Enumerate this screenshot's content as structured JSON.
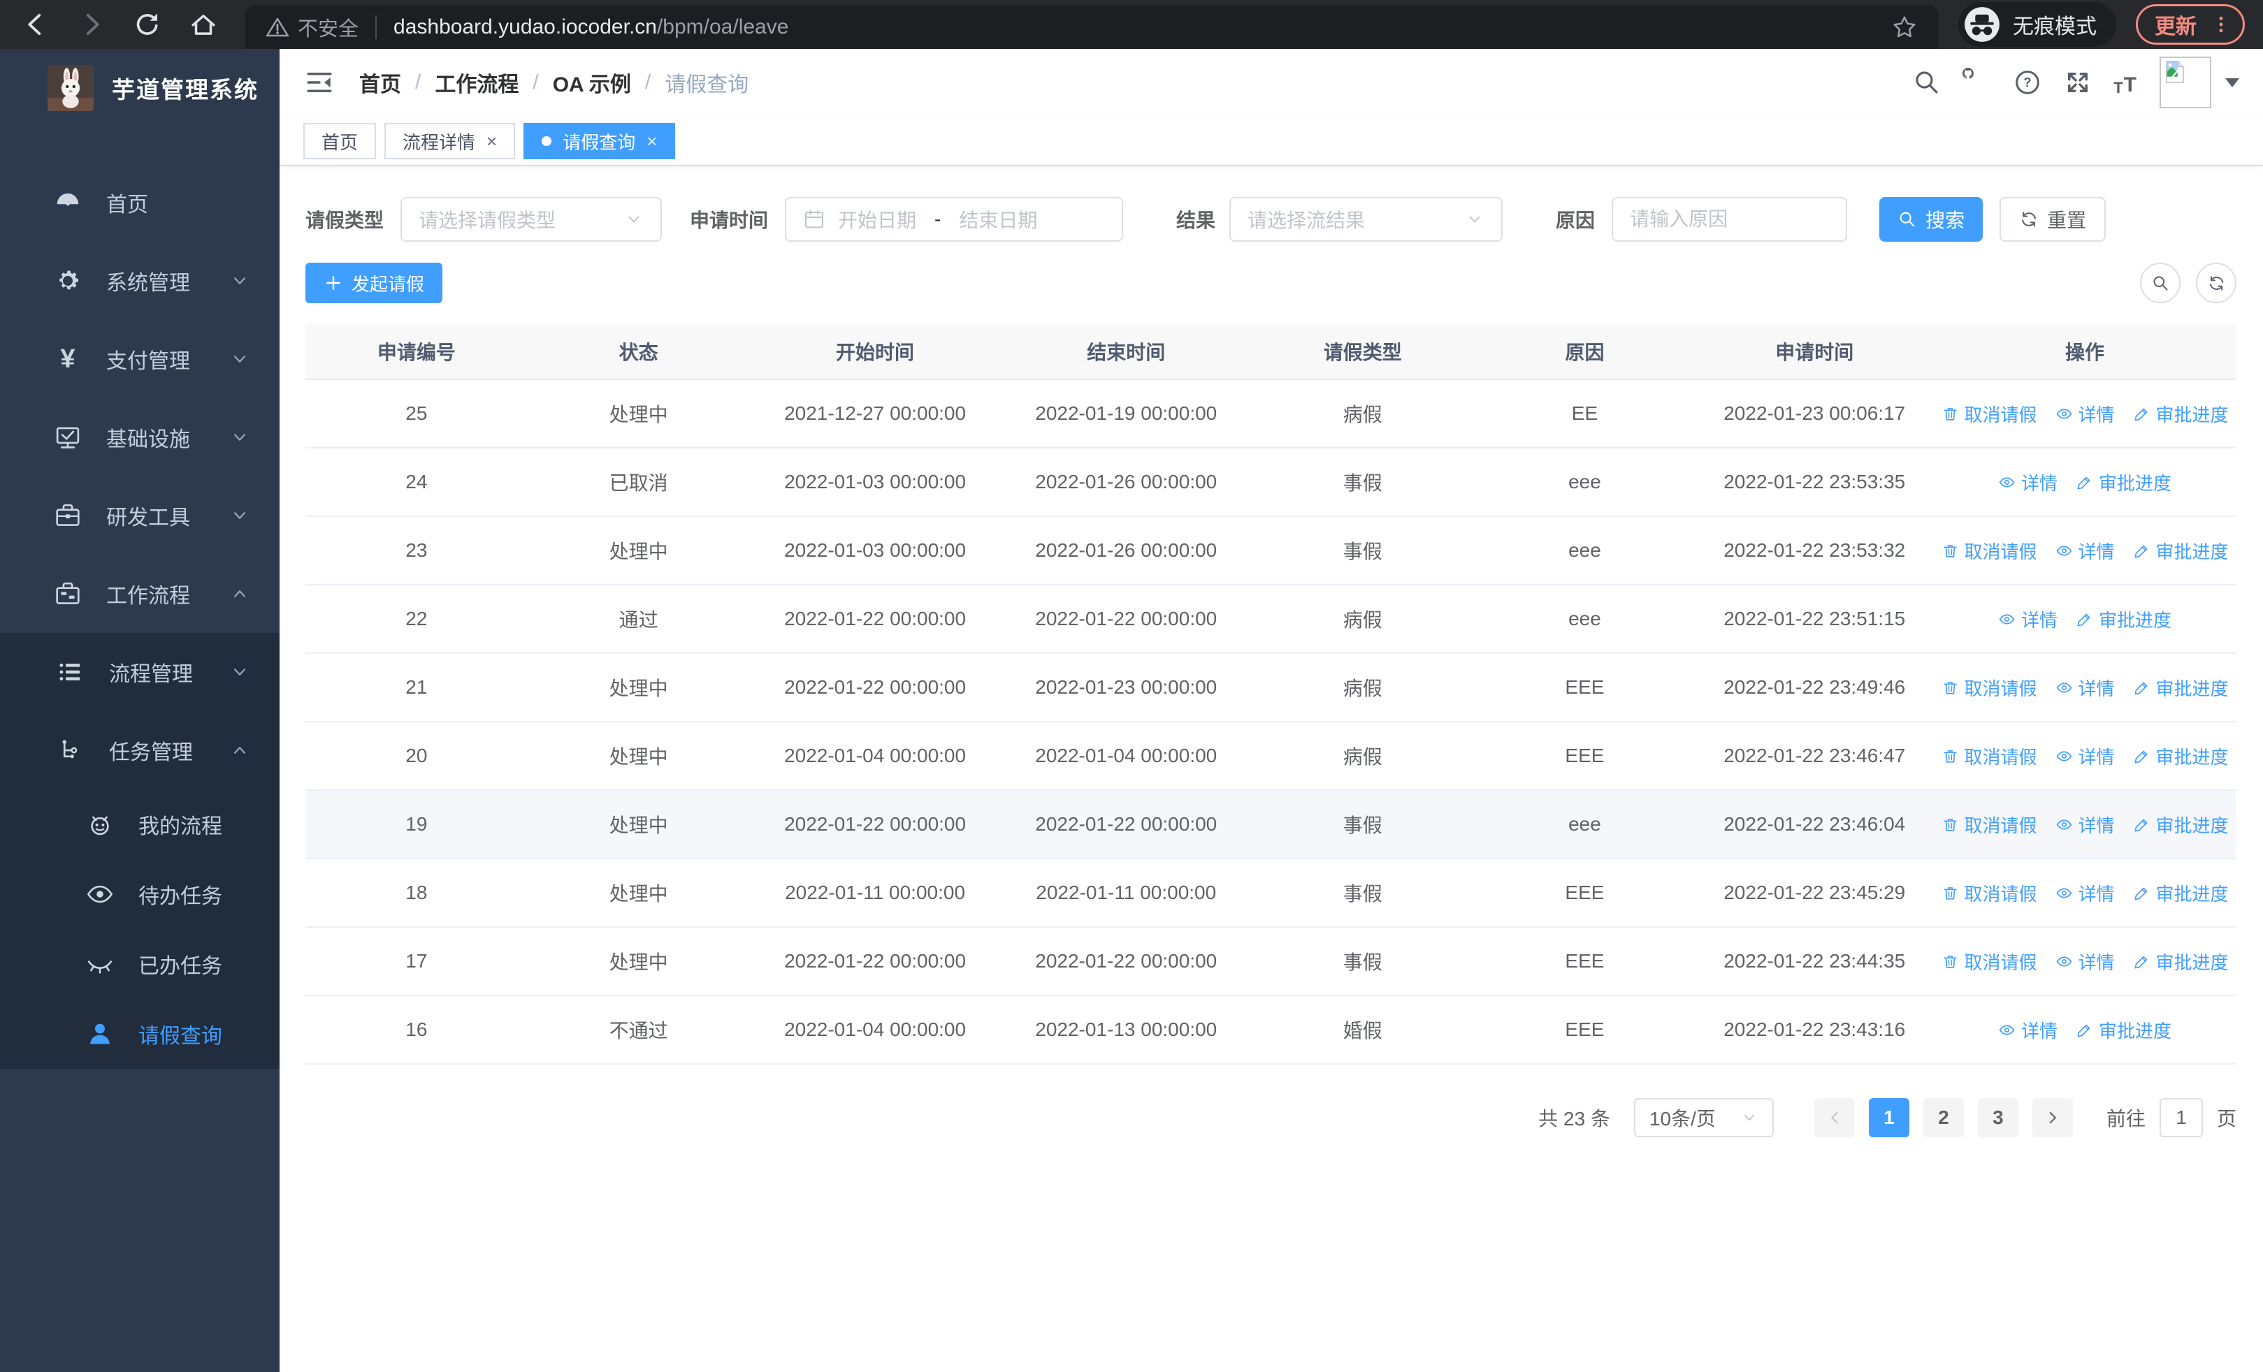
{
  "browser": {
    "security_label": "不安全",
    "url_host": "dashboard.yudao.iocoder.cn",
    "url_path": "/bpm/oa/leave",
    "incognito_label": "无痕模式",
    "update_label": "更新",
    "nav_icons": [
      "back-icon",
      "forward-icon",
      "reload-icon",
      "home-icon"
    ],
    "bookmark_icon": "star-icon",
    "menu_icon": "kebab-menu-icon"
  },
  "sidebar": {
    "logo_title": "芋道管理系统",
    "logo_icon": "rabbit-logo",
    "items": [
      {
        "label": "首页",
        "icon": "dashboard-icon",
        "chevron": null,
        "active": false
      },
      {
        "label": "系统管理",
        "icon": "gear-icon",
        "chevron": "down",
        "active": false
      },
      {
        "label": "支付管理",
        "icon": "yen-icon",
        "chevron": "down",
        "active": false
      },
      {
        "label": "基础设施",
        "icon": "monitor-icon",
        "chevron": "down",
        "active": false
      },
      {
        "label": "研发工具",
        "icon": "toolbox-icon",
        "chevron": "down",
        "active": false
      },
      {
        "label": "工作流程",
        "icon": "briefcase-icon",
        "chevron": "up",
        "active": false
      }
    ],
    "submenu": [
      {
        "label": "流程管理",
        "icon": "process-list-icon",
        "chevron": "down",
        "level": 1,
        "active": false
      },
      {
        "label": "任务管理",
        "icon": "task-flow-icon",
        "chevron": "up",
        "level": 1,
        "active": false
      },
      {
        "label": "我的流程",
        "icon": "robot-face-icon",
        "chevron": null,
        "level": 2,
        "active": false
      },
      {
        "label": "待办任务",
        "icon": "eye-open-icon",
        "chevron": null,
        "level": 2,
        "active": false
      },
      {
        "label": "已办任务",
        "icon": "eye-closed-icon",
        "chevron": null,
        "level": 2,
        "active": false
      },
      {
        "label": "请假查询",
        "icon": "user-icon",
        "chevron": null,
        "level": 2,
        "active": true
      }
    ]
  },
  "header": {
    "breadcrumb": [
      "首页",
      "工作流程",
      "OA 示例",
      "请假查询"
    ],
    "separator": "/",
    "icons": [
      "search-icon",
      "github-icon",
      "help-icon",
      "fullscreen-icon",
      "font-size-icon"
    ],
    "font_size_glyph": "T"
  },
  "tabs": [
    {
      "label": "首页",
      "closable": false,
      "active": false
    },
    {
      "label": "流程详情",
      "closable": true,
      "active": false
    },
    {
      "label": "请假查询",
      "closable": true,
      "active": true
    }
  ],
  "tab_close_glyph": "×",
  "filters": {
    "leave_type": {
      "label": "请假类型",
      "placeholder": "请选择请假类型"
    },
    "apply_time": {
      "label": "申请时间",
      "start_placeholder": "开始日期",
      "separator": "-",
      "end_placeholder": "结束日期"
    },
    "result": {
      "label": "结果",
      "placeholder": "请选择流结果"
    },
    "reason": {
      "label": "原因",
      "placeholder": "请输入原因"
    },
    "search_label": "搜索",
    "reset_label": "重置"
  },
  "toolbar": {
    "create_label": "发起请假"
  },
  "table": {
    "columns": [
      "申请编号",
      "状态",
      "开始时间",
      "结束时间",
      "请假类型",
      "原因",
      "申请时间",
      "操作"
    ],
    "action_icons": {
      "取消请假": "delete-icon",
      "详情": "view-icon",
      "审批进度": "edit-icon"
    },
    "rows": [
      {
        "id": "25",
        "status": "处理中",
        "start": "2021-12-27 00:00:00",
        "end": "2022-01-19 00:00:00",
        "type": "病假",
        "reason": "EE",
        "applied": "2022-01-23 00:06:17",
        "actions": [
          "取消请假",
          "详情",
          "审批进度"
        ],
        "highlighted": false
      },
      {
        "id": "24",
        "status": "已取消",
        "start": "2022-01-03 00:00:00",
        "end": "2022-01-26 00:00:00",
        "type": "事假",
        "reason": "eee",
        "applied": "2022-01-22 23:53:35",
        "actions": [
          "详情",
          "审批进度"
        ],
        "highlighted": false
      },
      {
        "id": "23",
        "status": "处理中",
        "start": "2022-01-03 00:00:00",
        "end": "2022-01-26 00:00:00",
        "type": "事假",
        "reason": "eee",
        "applied": "2022-01-22 23:53:32",
        "actions": [
          "取消请假",
          "详情",
          "审批进度"
        ],
        "highlighted": false
      },
      {
        "id": "22",
        "status": "通过",
        "start": "2022-01-22 00:00:00",
        "end": "2022-01-22 00:00:00",
        "type": "病假",
        "reason": "eee",
        "applied": "2022-01-22 23:51:15",
        "actions": [
          "详情",
          "审批进度"
        ],
        "highlighted": false
      },
      {
        "id": "21",
        "status": "处理中",
        "start": "2022-01-22 00:00:00",
        "end": "2022-01-23 00:00:00",
        "type": "病假",
        "reason": "EEE",
        "applied": "2022-01-22 23:49:46",
        "actions": [
          "取消请假",
          "详情",
          "审批进度"
        ],
        "highlighted": false
      },
      {
        "id": "20",
        "status": "处理中",
        "start": "2022-01-04 00:00:00",
        "end": "2022-01-04 00:00:00",
        "type": "病假",
        "reason": "EEE",
        "applied": "2022-01-22 23:46:47",
        "actions": [
          "取消请假",
          "详情",
          "审批进度"
        ],
        "highlighted": false
      },
      {
        "id": "19",
        "status": "处理中",
        "start": "2022-01-22 00:00:00",
        "end": "2022-01-22 00:00:00",
        "type": "事假",
        "reason": "eee",
        "applied": "2022-01-22 23:46:04",
        "actions": [
          "取消请假",
          "详情",
          "审批进度"
        ],
        "highlighted": true
      },
      {
        "id": "18",
        "status": "处理中",
        "start": "2022-01-11 00:00:00",
        "end": "2022-01-11 00:00:00",
        "type": "事假",
        "reason": "EEE",
        "applied": "2022-01-22 23:45:29",
        "actions": [
          "取消请假",
          "详情",
          "审批进度"
        ],
        "highlighted": false
      },
      {
        "id": "17",
        "status": "处理中",
        "start": "2022-01-22 00:00:00",
        "end": "2022-01-22 00:00:00",
        "type": "事假",
        "reason": "EEE",
        "applied": "2022-01-22 23:44:35",
        "actions": [
          "取消请假",
          "详情",
          "审批进度"
        ],
        "highlighted": false
      },
      {
        "id": "16",
        "status": "不通过",
        "start": "2022-01-04 00:00:00",
        "end": "2022-01-13 00:00:00",
        "type": "婚假",
        "reason": "EEE",
        "applied": "2022-01-22 23:43:16",
        "actions": [
          "详情",
          "审批进度"
        ],
        "highlighted": false
      }
    ]
  },
  "pagination": {
    "total_label": "共 23 条",
    "page_size_label": "10条/页",
    "pages": [
      "1",
      "2",
      "3"
    ],
    "active_page": "1",
    "goto_label": "前往",
    "goto_value": "1",
    "unit_label": "页"
  },
  "colors": {
    "primary": "#409eff",
    "sidebar_bg": "#2d3a4d",
    "submenu_bg": "#212c3c",
    "sidebar_text": "#c3cddb",
    "table_header_bg": "#f8f8f9",
    "row_hover_bg": "#f5f7fa",
    "action_link": "#409eff",
    "update_badge": "#f28b82",
    "browser_bar_bg": "#28292c",
    "url_box_bg": "#1d1e21"
  }
}
